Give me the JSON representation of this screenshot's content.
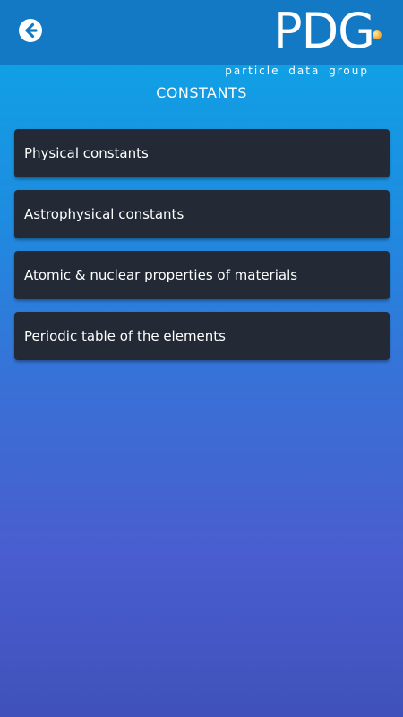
{
  "header": {
    "back_icon": "arrow-left-circle-icon",
    "logo_mark": "PDG",
    "logo_subtitle": "particle data group",
    "logo_dot_color": "#f6b23a"
  },
  "page": {
    "title": "CONSTANTS"
  },
  "menu": {
    "items": [
      {
        "label": "Physical constants"
      },
      {
        "label": "Astrophysical constants"
      },
      {
        "label": "Atomic & nuclear properties of materials"
      },
      {
        "label": "Periodic table of the elements"
      }
    ]
  },
  "colors": {
    "header_bg": "#1479c4",
    "card_bg": "#232a35",
    "text": "#ffffff"
  }
}
